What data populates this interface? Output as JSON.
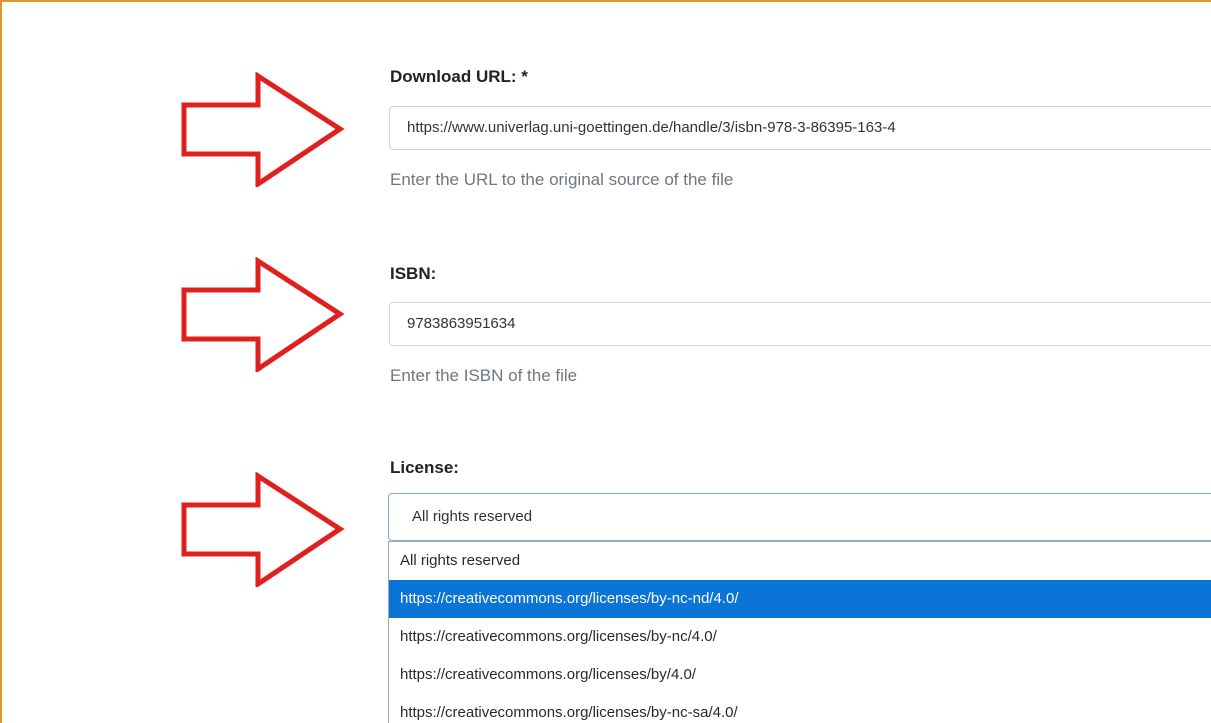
{
  "download_url": {
    "label": "Download URL: *",
    "value": "https://www.univerlag.uni-goettingen.de/handle/3/isbn-978-3-86395-163-4",
    "help": "Enter the URL to the original source of the file"
  },
  "isbn": {
    "label": "ISBN:",
    "value": "9783863951634",
    "help": "Enter the ISBN of the file"
  },
  "license": {
    "label": "License:",
    "selected_value": "All rights reserved",
    "options": [
      "All rights reserved",
      "https://creativecommons.org/licenses/by-nc-nd/4.0/",
      "https://creativecommons.org/licenses/by-nc/4.0/",
      "https://creativecommons.org/licenses/by/4.0/",
      "https://creativecommons.org/licenses/by-nc-sa/4.0/"
    ],
    "highlighted_option_index": 1
  },
  "colors": {
    "frame_border": "#e0962e",
    "annotation_arrow": "#e0201e",
    "highlight": "#0a75d6",
    "help_text": "#6f7780"
  },
  "icons": [
    "annotation-arrow-icon"
  ]
}
